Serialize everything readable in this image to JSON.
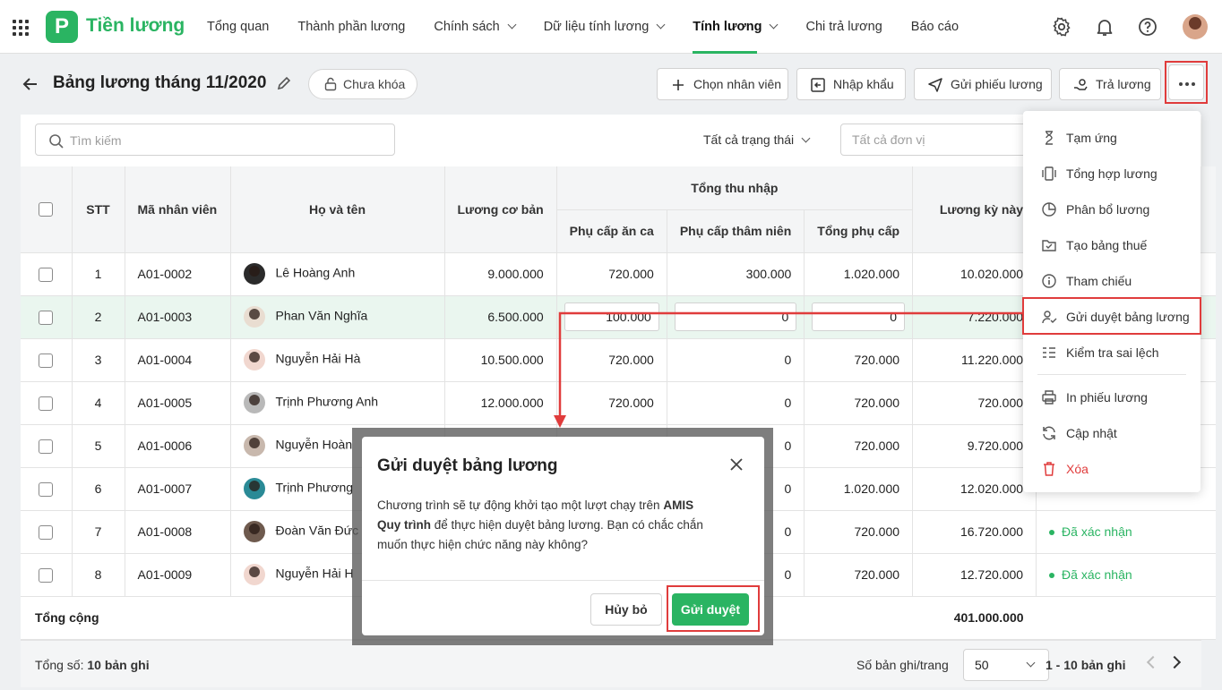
{
  "app": {
    "name": "Tiền lương",
    "logo_letter": "P",
    "accent": "#2ab462"
  },
  "nav": [
    "Tổng quan",
    "Thành phần lương",
    "Chính sách",
    "Dữ liệu tính lương",
    "Tính lương",
    "Chi trả lương",
    "Báo cáo"
  ],
  "header": {
    "title": "Bảng lương tháng 11/2020",
    "lock_status": "Chưa khóa",
    "buttons": {
      "choose": "Chọn nhân viên",
      "import": "Nhập khẩu",
      "send": "Gửi phiếu lương",
      "pay": "Trả lương"
    }
  },
  "toolbar": {
    "search_placeholder": "Tìm kiếm",
    "status_filter": "Tất cả trạng thái",
    "unit_placeholder": "Tất cả đơn vị"
  },
  "table": {
    "headers": {
      "stt": "STT",
      "code": "Mã nhân viên",
      "name": "Họ và tên",
      "base": "Lương cơ bản",
      "income_group": "Tổng thu nhập",
      "meal": "Phụ cấp ăn ca",
      "senior": "Phụ cấp thâm niên",
      "allow": "Tổng phụ cấp",
      "period": "Lương kỳ này"
    },
    "rows": [
      {
        "stt": "1",
        "code": "A01-0002",
        "name": "Lê Hoàng Anh",
        "base": "9.000.000",
        "meal": "720.000",
        "senior": "300.000",
        "allow": "1.020.000",
        "period": "10.020.000",
        "status": ""
      },
      {
        "stt": "2",
        "code": "A01-0003",
        "name": "Phan Văn Nghĩa",
        "base": "6.500.000",
        "meal": "100.000",
        "senior": "0",
        "allow": "0",
        "period": "7.220.000",
        "status": ""
      },
      {
        "stt": "3",
        "code": "A01-0004",
        "name": "Nguyễn Hải Hà",
        "base": "10.500.000",
        "meal": "720.000",
        "senior": "0",
        "allow": "720.000",
        "period": "11.220.000",
        "status": ""
      },
      {
        "stt": "4",
        "code": "A01-0005",
        "name": "Trịnh Phương Anh",
        "base": "12.000.000",
        "meal": "720.000",
        "senior": "0",
        "allow": "720.000",
        "period": "720.000",
        "status": ""
      },
      {
        "stt": "5",
        "code": "A01-0006",
        "name": "Nguyễn Hoàn",
        "base": "",
        "meal": "",
        "senior": "0",
        "allow": "720.000",
        "period": "9.720.000",
        "status": ""
      },
      {
        "stt": "6",
        "code": "A01-0007",
        "name": "Trịnh Phương",
        "base": "",
        "meal": "",
        "senior": "0",
        "allow": "1.020.000",
        "period": "12.020.000",
        "status": ""
      },
      {
        "stt": "7",
        "code": "A01-0008",
        "name": "Đoàn Văn Đức",
        "base": "",
        "meal": "",
        "senior": "0",
        "allow": "720.000",
        "period": "16.720.000",
        "status": "Đã xác nhận"
      },
      {
        "stt": "8",
        "code": "A01-0009",
        "name": "Nguyễn Hải H",
        "base": "",
        "meal": "",
        "senior": "0",
        "allow": "720.000",
        "period": "12.720.000",
        "status": "Đã xác nhận"
      }
    ],
    "total_label": "Tổng cộng",
    "total_period": "401.000.000"
  },
  "footer": {
    "total_prefix": "Tổng số:",
    "total_count": "10 bản ghi",
    "per_page_label": "Số bản ghi/trang",
    "per_page": "50",
    "range": "1 - 10 bản ghi"
  },
  "menu": [
    "Tạm ứng",
    "Tổng hợp lương",
    "Phân bổ lương",
    "Tạo bảng thuế",
    "Tham chiếu",
    "Gửi duyệt bảng lương",
    "Kiểm tra sai lệch",
    "In phiếu lương",
    "Cập nhật",
    "Xóa"
  ],
  "dialog": {
    "title": "Gửi duyệt bảng lương",
    "body_1": "Chương trình sẽ tự động khởi tạo một lượt chạy trên ",
    "body_bold": "AMIS Quy trình",
    "body_2": " để thực hiện duyệt bảng lương. Bạn có chắc chắn muốn thực hiện chức năng này không?",
    "cancel": "Hủy bỏ",
    "confirm": "Gửi duyệt"
  }
}
